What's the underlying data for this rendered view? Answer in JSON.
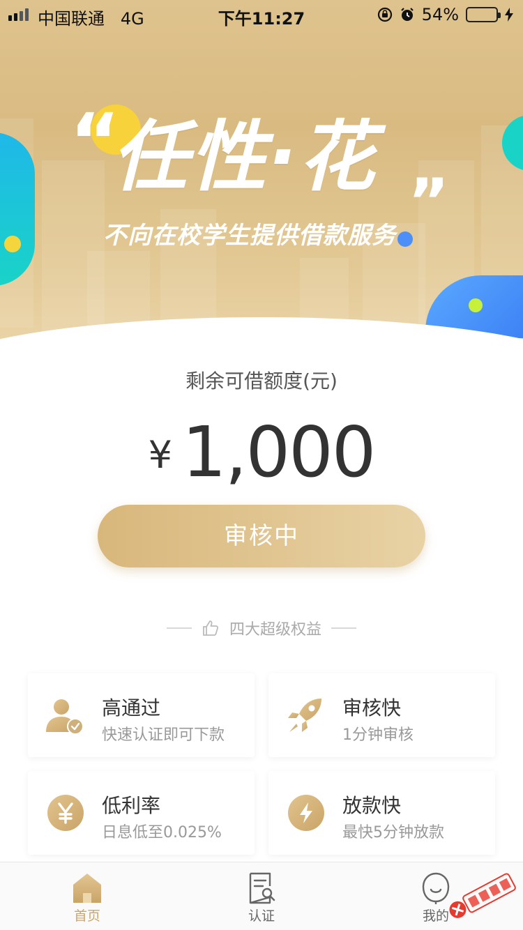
{
  "status_bar": {
    "carrier": "中国联通",
    "network": "4G",
    "time": "下午11:27",
    "battery_percent_text": "54%",
    "battery_level": 0.54
  },
  "banner": {
    "slogan_title": "任性·花",
    "slogan_subtitle": "不向在校学生提供借款服务"
  },
  "credit": {
    "label": "剩余可借额度(元)",
    "currency_symbol": "¥",
    "amount": "1,000"
  },
  "review_button": {
    "label": "审核中"
  },
  "benefits": {
    "title": "四大超级权益",
    "items": [
      {
        "title": "高通过",
        "subtitle": "快速认证即可下款",
        "icon": "user-check-icon"
      },
      {
        "title": "审核快",
        "subtitle": "1分钟审核",
        "icon": "rocket-icon"
      },
      {
        "title": "低利率",
        "subtitle": "日息低至0.025%",
        "icon": "yen-icon"
      },
      {
        "title": "放款快",
        "subtitle": "最快5分钟放款",
        "icon": "lightning-icon"
      }
    ]
  },
  "tabbar": {
    "tabs": [
      {
        "label": "首页",
        "icon": "home-icon",
        "active": true
      },
      {
        "label": "认证",
        "icon": "document-search-icon",
        "active": false
      },
      {
        "label": "我的",
        "icon": "profile-icon",
        "active": false
      }
    ]
  },
  "colors": {
    "gold_accent": "#c9a66b",
    "button_gradient_start": "#d8b77b",
    "button_gradient_end": "#e8d2a5",
    "banner_gold": "#dcc089",
    "teal": "#19d3c7",
    "blue": "#3b7ff5"
  }
}
